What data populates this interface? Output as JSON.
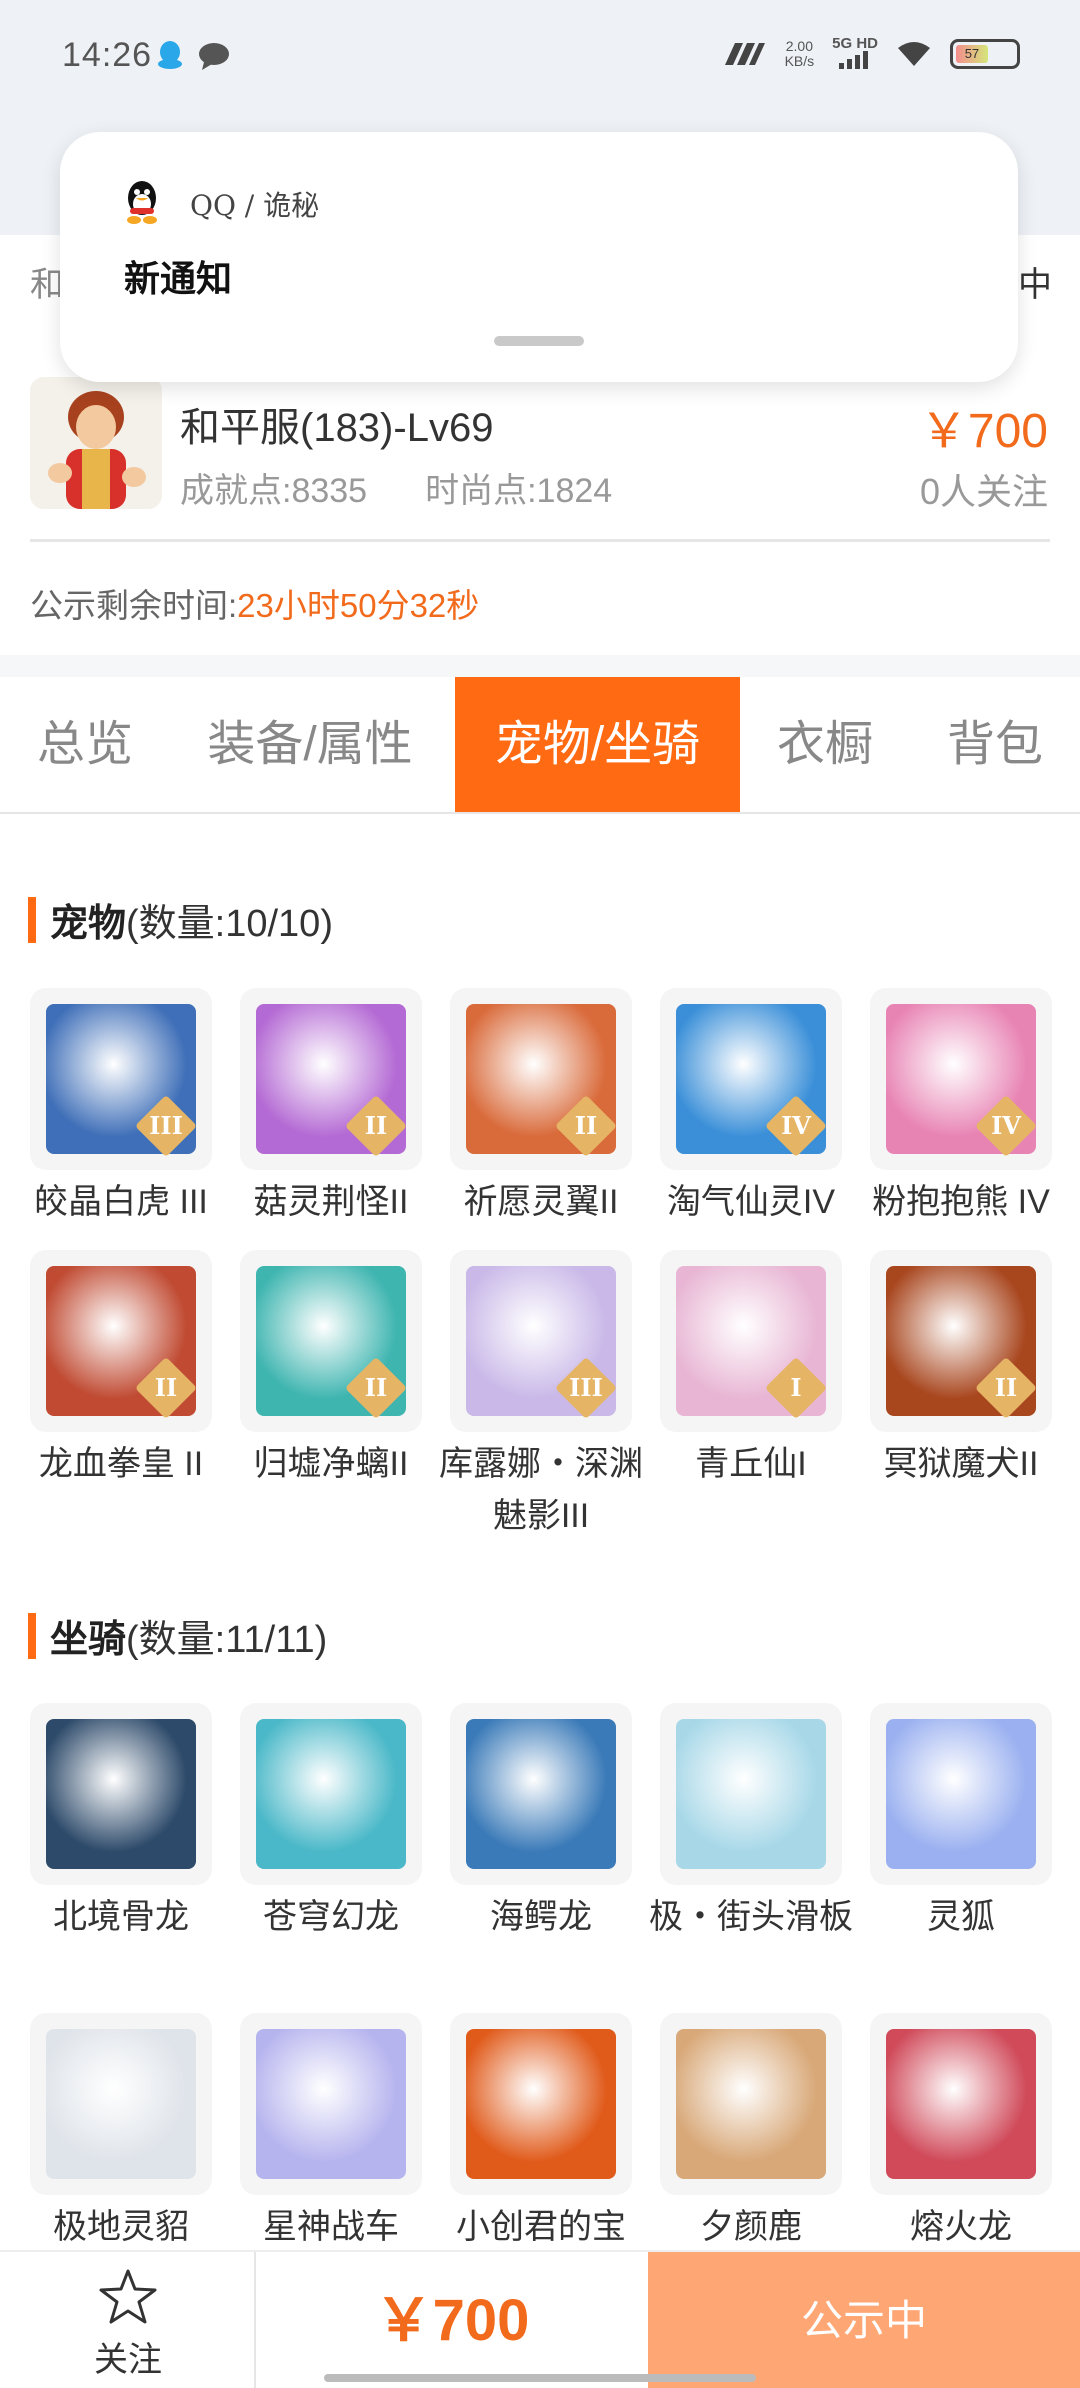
{
  "status_bar": {
    "time": "14:26",
    "speed_value": "2.00",
    "speed_unit": "KB/s",
    "network": "5G HD",
    "battery": "57"
  },
  "header": {
    "left_text": "和",
    "right_text": "中"
  },
  "notification": {
    "app": "QQ / 诡秘",
    "title": "新通知"
  },
  "item": {
    "name": "和平服(183)-Lv69",
    "achievement": "成就点:8335",
    "fashion": "时尚点:1824",
    "price": "￥700",
    "followers": "0人关注",
    "countdown_label": "公示剩余时间:",
    "countdown_value": "23小时50分32秒"
  },
  "tabs": [
    {
      "label": "总览",
      "active": false
    },
    {
      "label": "装备/属性",
      "active": false
    },
    {
      "label": "宠物/坐骑",
      "active": true
    },
    {
      "label": "衣橱",
      "active": false
    },
    {
      "label": "背包",
      "active": false
    }
  ],
  "pets": {
    "title": "宠物",
    "count": "(数量:10/10)",
    "items": [
      {
        "name": "皎晶白虎 III",
        "tier": "III",
        "color": "#3f6fb8"
      },
      {
        "name": "菇灵荆怪II",
        "tier": "II",
        "color": "#b46ad4"
      },
      {
        "name": "祈愿灵翼II",
        "tier": "II",
        "color": "#d96a3a"
      },
      {
        "name": "淘气仙灵IV",
        "tier": "IV",
        "color": "#3a8fd8"
      },
      {
        "name": "粉抱抱熊 IV",
        "tier": "IV",
        "color": "#e884b4"
      },
      {
        "name": "龙血拳皇 II",
        "tier": "II",
        "color": "#c04a32"
      },
      {
        "name": "归墟净螭II",
        "tier": "II",
        "color": "#3fb5b0"
      },
      {
        "name": "库露娜・深渊魅影III",
        "tier": "III",
        "color": "#c9b8e8"
      },
      {
        "name": "青丘仙I",
        "tier": "I",
        "color": "#e8b6d4"
      },
      {
        "name": "冥狱魔犬II",
        "tier": "II",
        "color": "#a8461e"
      }
    ]
  },
  "mounts": {
    "title": "坐骑",
    "count": "(数量:11/11)",
    "items": [
      {
        "name": "北境骨龙",
        "color": "#2d4a6a"
      },
      {
        "name": "苍穹幻龙",
        "color": "#4ab8c8"
      },
      {
        "name": "海鳄龙",
        "color": "#3a7ab8"
      },
      {
        "name": "极・街头滑板",
        "color": "#a8d8e8"
      },
      {
        "name": "灵狐",
        "color": "#9ab0f0"
      },
      {
        "name": "极地灵貂",
        "color": "#dfe4ea"
      },
      {
        "name": "星神战车",
        "color": "#b6b4ee"
      },
      {
        "name": "小创君的宝",
        "color": "#e05a1a"
      },
      {
        "name": "夕颜鹿",
        "color": "#d8a878"
      },
      {
        "name": "熔火龙",
        "color": "#d04a5a"
      }
    ]
  },
  "bottom_bar": {
    "follow_label": "关注",
    "price": "￥700",
    "status_label": "公示中"
  }
}
